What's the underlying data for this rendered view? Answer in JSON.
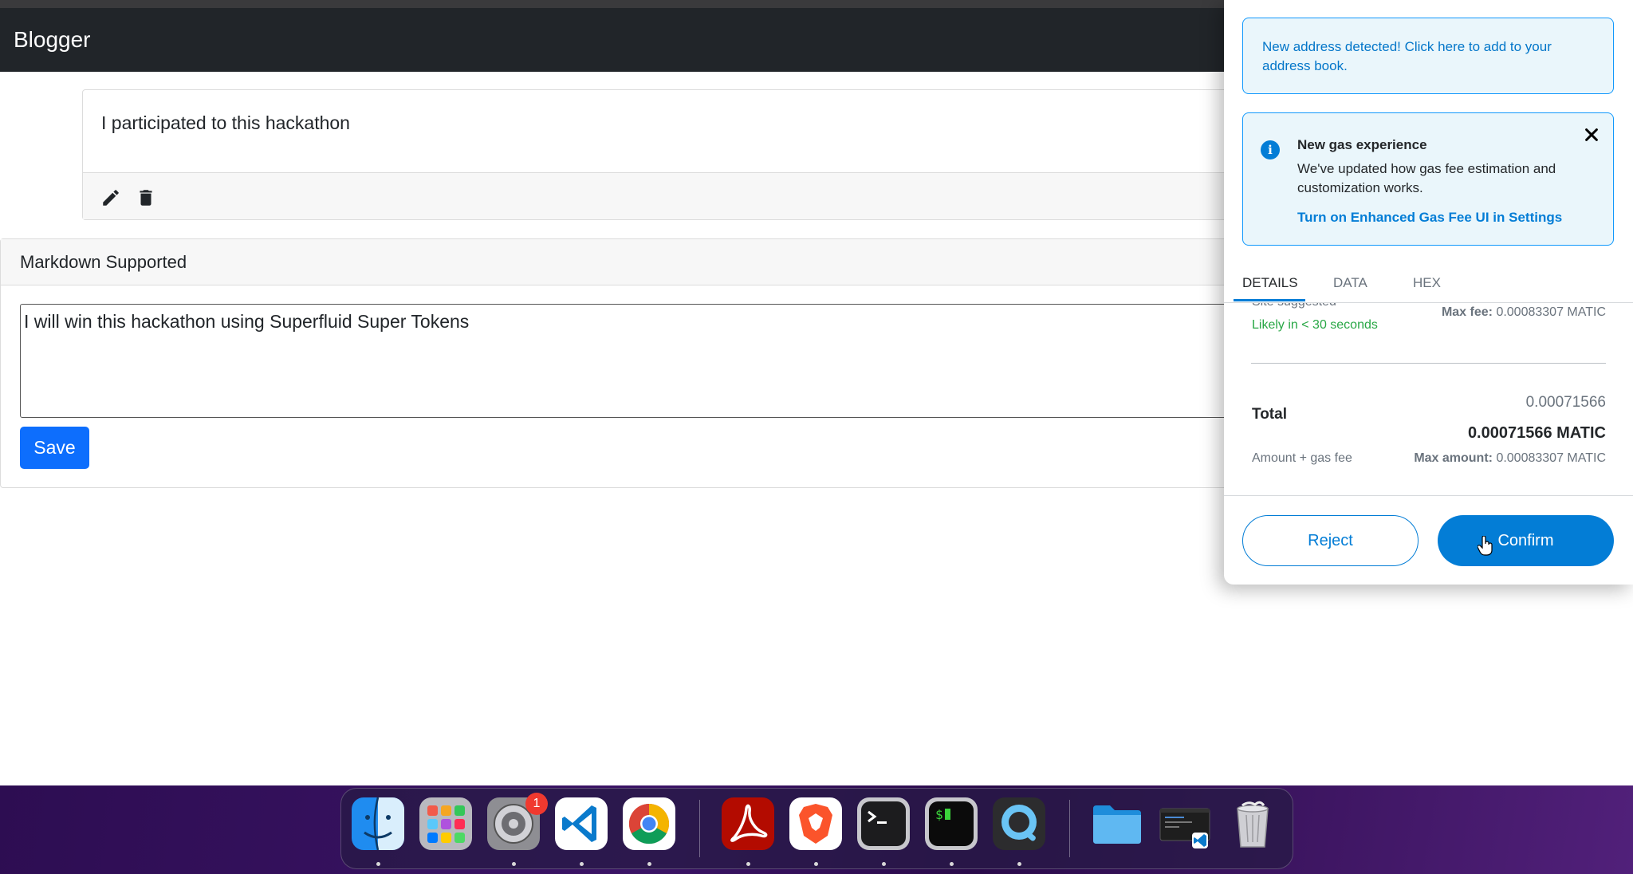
{
  "app": {
    "brand": "Blogger"
  },
  "post": {
    "text": "I participated to this hackathon"
  },
  "editor": {
    "title": "Markdown Supported",
    "value": "I will win this hackathon using Superfluid Super Tokens",
    "save_label": "Save"
  },
  "metamask": {
    "address_alert": "New address detected! Click here to add to your address book.",
    "gas_alert": {
      "title": "New gas experience",
      "body": "We've updated how gas fee estimation and customization works.",
      "link": "Turn on Enhanced Gas Fee UI in Settings"
    },
    "tabs": [
      {
        "label": "DETAILS",
        "active": true
      },
      {
        "label": "DATA",
        "active": false
      },
      {
        "label": "HEX",
        "active": false
      }
    ],
    "fee": {
      "site_suggested": "Site suggested",
      "likely": "Likely in < 30 seconds",
      "max_fee_label": "Max fee:",
      "max_fee_value": "0.00083307 MATIC"
    },
    "total": {
      "label": "Total",
      "amount_small": "0.00071566",
      "amount_big": "0.00071566 MATIC",
      "sub_label": "Amount + gas fee",
      "max_amount_label": "Max amount:",
      "max_amount_value": "0.00083307 MATIC"
    },
    "buttons": {
      "reject": "Reject",
      "confirm": "Confirm"
    },
    "colors": {
      "accent": "#037dd6",
      "success": "#28a745"
    }
  },
  "dock": {
    "items": [
      {
        "icon": "finder-icon",
        "running": true
      },
      {
        "icon": "launchpad-icon",
        "running": false
      },
      {
        "icon": "system-preferences-icon",
        "running": true,
        "badge": "1"
      },
      {
        "icon": "vscode-icon",
        "running": true
      },
      {
        "icon": "chrome-icon",
        "running": true
      },
      {
        "icon": "acrobat-icon",
        "running": true
      },
      {
        "icon": "brave-icon",
        "running": true
      },
      {
        "icon": "terminal-icon",
        "running": true
      },
      {
        "icon": "iterm-icon",
        "running": true
      },
      {
        "icon": "quicktime-icon",
        "running": true
      },
      {
        "icon": "folder-icon",
        "running": false
      },
      {
        "icon": "vscode-window-icon",
        "running": false
      },
      {
        "icon": "trash-icon",
        "running": false
      }
    ]
  }
}
